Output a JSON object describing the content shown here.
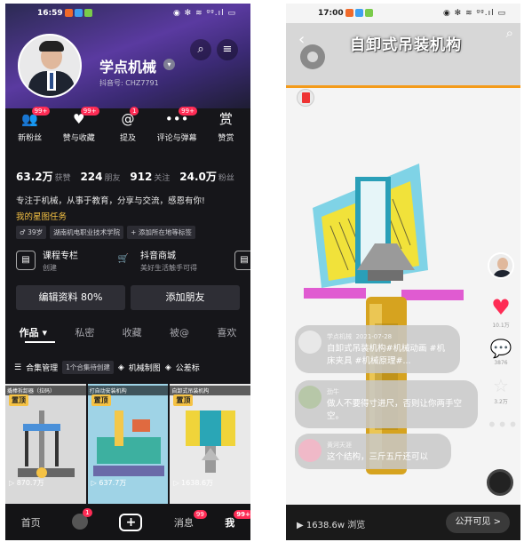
{
  "left": {
    "status": {
      "time": "16:59",
      "icons": "◉ ✻ ≋ ᵍᵍ.ıl ▭"
    },
    "profile": {
      "name": "学点机械",
      "douyin_id": "抖音号: CHZ7791",
      "menu_glyph": "≡",
      "search_glyph": "⌕"
    },
    "quick_icons": [
      {
        "label": "新粉丝",
        "glyph": "👥",
        "badge": "99+",
        "icon": "new-fans-icon"
      },
      {
        "label": "赞与收藏",
        "glyph": "♥",
        "badge": "99+",
        "icon": "like-icon"
      },
      {
        "label": "提及",
        "glyph": "@",
        "badge": "1",
        "icon": "mention-icon"
      },
      {
        "label": "评论与弹幕",
        "glyph": "•••",
        "badge": "99+",
        "icon": "comment-icon"
      },
      {
        "label": "赞赏",
        "glyph": "赏",
        "badge": "",
        "icon": "reward-icon"
      }
    ],
    "stats": [
      {
        "value": "63.2万",
        "label": "获赞"
      },
      {
        "value": "224",
        "label": "朋友"
      },
      {
        "value": "912",
        "label": "关注"
      },
      {
        "value": "24.0万",
        "label": "粉丝"
      }
    ],
    "bio": "专注于机械，从事于教育，分享与交流，感恩有你!",
    "star_task": "我的星图任务",
    "tags": [
      "♂ 39岁",
      "湖南机电职业技术学院",
      "+ 添加所在地等标签"
    ],
    "features": [
      {
        "title": "课程专栏",
        "sub": "创建",
        "glyph": "▤"
      },
      {
        "title": "抖音商城",
        "sub": "美好生活触手可得",
        "glyph": "🛒"
      }
    ],
    "edit_profile": "编辑资料 80%",
    "add_friend": "添加朋友",
    "tabs": [
      "作品 ▾",
      "私密",
      "收藏",
      "被@",
      "喜欢"
    ],
    "sub_row": {
      "collection": "合集管理",
      "collection_count": "1个合集待创建",
      "folder1": "机械制图",
      "folder2": "公差标"
    },
    "thumbs": [
      {
        "caption": "撬棒拆卸器（拉码）",
        "pinned": "置顶",
        "plays": "870.7万",
        "bg": "#c9c9c9"
      },
      {
        "caption": "打自动安装机构",
        "pinned": "置顶",
        "plays": "637.7万",
        "bg": "#8ccbe0"
      },
      {
        "caption": "自卸式吊装机构",
        "pinned": "置顶",
        "plays": "1638.6万",
        "bg": "#e7e7e7"
      }
    ],
    "nav": [
      {
        "label": "首页"
      },
      {
        "label": "",
        "badge": "1"
      },
      {
        "label": "+"
      },
      {
        "label": "消息",
        "badge": "99"
      },
      {
        "label": "我",
        "badge": "99+"
      }
    ]
  },
  "right": {
    "status": {
      "time": "17:00",
      "icons": "◉ ✻ ≋ ᵍᵍ.ıl ▭"
    },
    "title": "自卸式吊装机构",
    "like_count": "10.1万",
    "comment_count": "3876",
    "share_count": "3.2万",
    "comments": [
      {
        "name": "学点机械",
        "date": "2021-07-28",
        "text": "自卸式吊装机构#机械动画 #机床夹具 #机械原理#..."
      },
      {
        "name": "劲牛",
        "text": "做人不要得寸进尺，否则让你两手空空。"
      },
      {
        "name": "黄河天涯",
        "text": "这个结构，三斤五斤还可以"
      }
    ],
    "views": "▶ 1638.6w 浏览",
    "visibility": "公开可见 >"
  },
  "colors": {
    "accent": "#fe2c55",
    "gold": "#f5c244",
    "orange": "#f49b1a"
  }
}
